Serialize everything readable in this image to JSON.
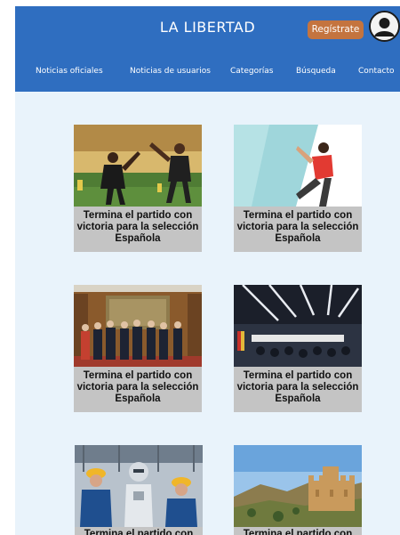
{
  "header": {
    "site_title": "LA LIBERTAD",
    "register_label": "Regístrate",
    "avatar_icon": "user-avatar-icon"
  },
  "nav": {
    "items": [
      {
        "label": "Noticias oficiales"
      },
      {
        "label": "Noticias de usuarios"
      },
      {
        "label": "Categorías"
      },
      {
        "label": "Búsqueda"
      },
      {
        "label": "Contacto"
      }
    ]
  },
  "articles": [
    {
      "caption": "Termina el partido con victoria para la selección Española",
      "image": "soccer-players-photo"
    },
    {
      "caption": "Termina el partido con victoria para la selección Española",
      "image": "climber-photo"
    },
    {
      "caption": "Termina el partido con victoria para la selección Española",
      "image": "official-ceremony-photo"
    },
    {
      "caption": "Termina el partido con victoria para la selección Española",
      "image": "press-conference-photo"
    },
    {
      "caption": "Termina el partido con",
      "image": "robot-workers-photo"
    },
    {
      "caption": "Termina el partido con",
      "image": "castle-landscape-photo"
    }
  ],
  "colors": {
    "header_bg": "#2f6ec0",
    "page_bg": "#e9f3fb",
    "register_bg": "#c4743f",
    "caption_bg": "#c4c4c4"
  }
}
